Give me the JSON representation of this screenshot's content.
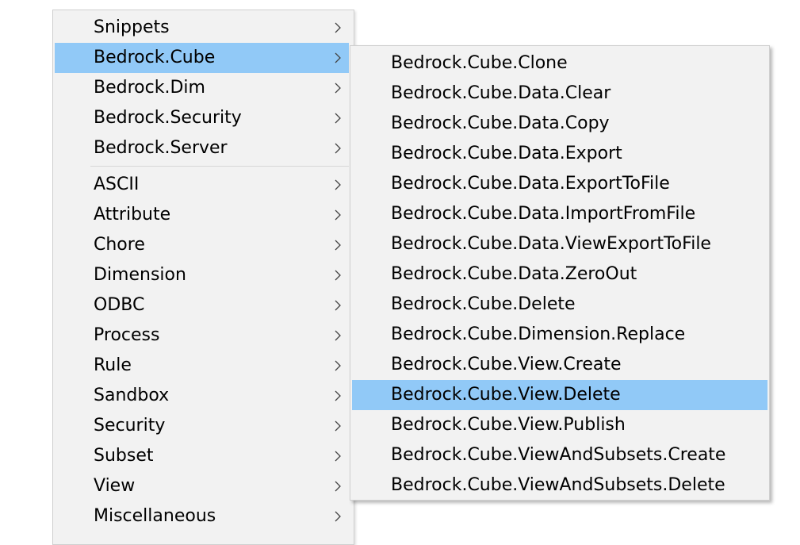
{
  "main_menu": {
    "group1": [
      {
        "label": "Snippets",
        "has_submenu": true,
        "highlighted": false
      },
      {
        "label": "Bedrock.Cube",
        "has_submenu": true,
        "highlighted": true
      },
      {
        "label": "Bedrock.Dim",
        "has_submenu": true,
        "highlighted": false
      },
      {
        "label": "Bedrock.Security",
        "has_submenu": true,
        "highlighted": false
      },
      {
        "label": "Bedrock.Server",
        "has_submenu": true,
        "highlighted": false
      }
    ],
    "group2": [
      {
        "label": "ASCII",
        "has_submenu": true
      },
      {
        "label": "Attribute",
        "has_submenu": true
      },
      {
        "label": "Chore",
        "has_submenu": true
      },
      {
        "label": "Dimension",
        "has_submenu": true
      },
      {
        "label": "ODBC",
        "has_submenu": true
      },
      {
        "label": "Process",
        "has_submenu": true
      },
      {
        "label": "Rule",
        "has_submenu": true
      },
      {
        "label": "Sandbox",
        "has_submenu": true
      },
      {
        "label": "Security",
        "has_submenu": true
      },
      {
        "label": "Subset",
        "has_submenu": true
      },
      {
        "label": "View",
        "has_submenu": true
      },
      {
        "label": "Miscellaneous",
        "has_submenu": true
      }
    ]
  },
  "sub_menu": {
    "items": [
      {
        "label": "Bedrock.Cube.Clone",
        "highlighted": false
      },
      {
        "label": "Bedrock.Cube.Data.Clear",
        "highlighted": false
      },
      {
        "label": "Bedrock.Cube.Data.Copy",
        "highlighted": false
      },
      {
        "label": "Bedrock.Cube.Data.Export",
        "highlighted": false
      },
      {
        "label": "Bedrock.Cube.Data.ExportToFile",
        "highlighted": false
      },
      {
        "label": "Bedrock.Cube.Data.ImportFromFile",
        "highlighted": false
      },
      {
        "label": "Bedrock.Cube.Data.ViewExportToFile",
        "highlighted": false
      },
      {
        "label": "Bedrock.Cube.Data.ZeroOut",
        "highlighted": false
      },
      {
        "label": "Bedrock.Cube.Delete",
        "highlighted": false
      },
      {
        "label": "Bedrock.Cube.Dimension.Replace",
        "highlighted": false
      },
      {
        "label": "Bedrock.Cube.View.Create",
        "highlighted": false
      },
      {
        "label": "Bedrock.Cube.View.Delete",
        "highlighted": true
      },
      {
        "label": "Bedrock.Cube.View.Publish",
        "highlighted": false
      },
      {
        "label": "Bedrock.Cube.ViewAndSubsets.Create",
        "highlighted": false
      },
      {
        "label": "Bedrock.Cube.ViewAndSubsets.Delete",
        "highlighted": false
      }
    ]
  },
  "icons": {
    "submenu_arrow": "chevron-right-icon"
  },
  "colors": {
    "menu_background": "#f2f2f2",
    "highlight": "#91c9f7",
    "border": "#cfcfcf",
    "separator": "#d7d7d7",
    "text": "#000000"
  }
}
